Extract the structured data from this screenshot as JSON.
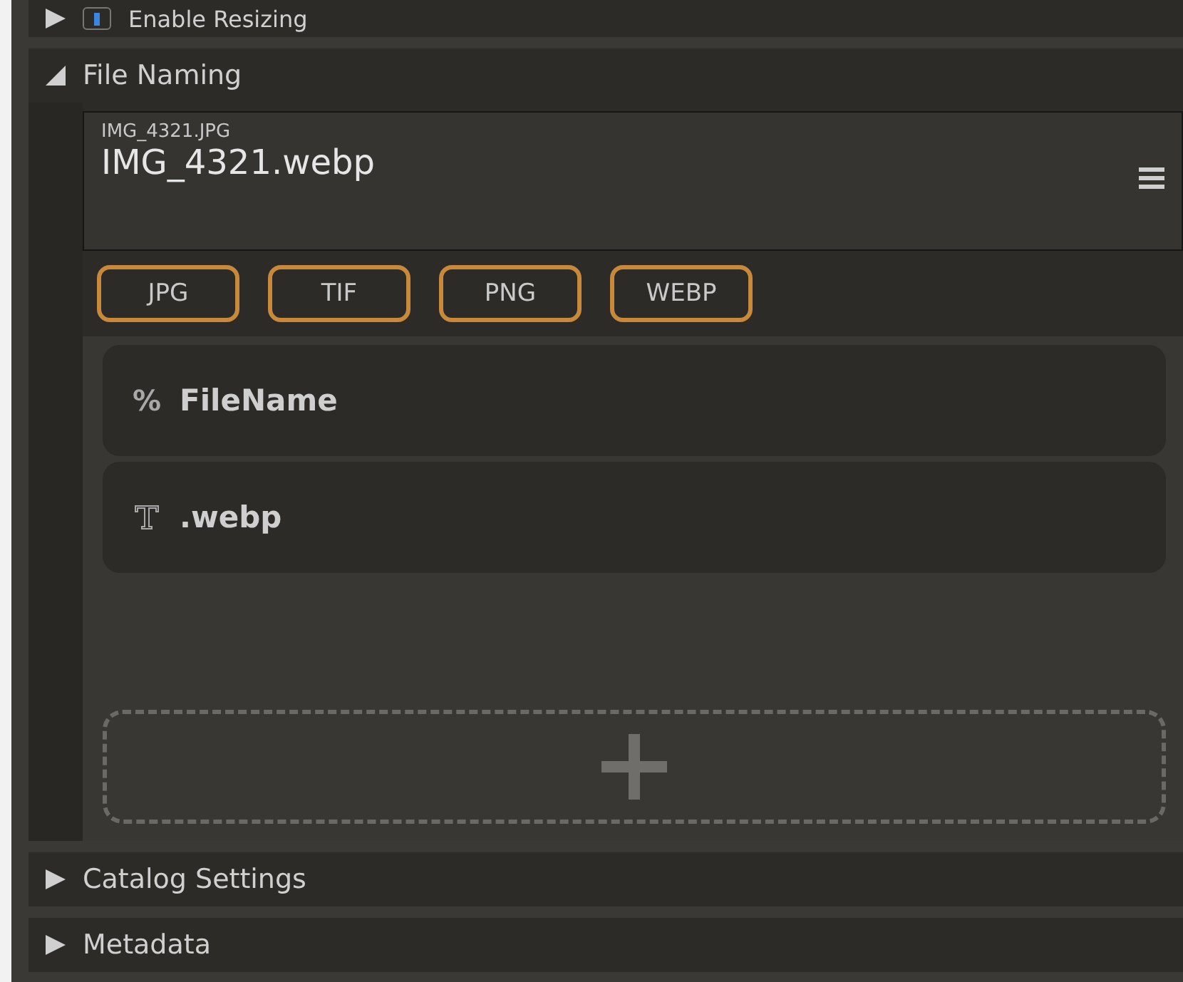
{
  "sections": [
    {
      "title": "Enable Resizing",
      "expanded": false,
      "checkbox": {
        "checked": true
      }
    },
    {
      "title": "File Naming",
      "expanded": true,
      "preview": {
        "original": "IMG_4321.JPG",
        "result": "IMG_4321.webp"
      },
      "formats": [
        "JPG",
        "TIF",
        "PNG",
        "WEBP"
      ],
      "tokens": [
        {
          "kind": "variable",
          "symbol": "%",
          "label": "FileName"
        },
        {
          "kind": "text",
          "label": ".webp"
        }
      ]
    },
    {
      "title": "Catalog Settings",
      "expanded": false
    },
    {
      "title": "Metadata",
      "expanded": false
    }
  ]
}
